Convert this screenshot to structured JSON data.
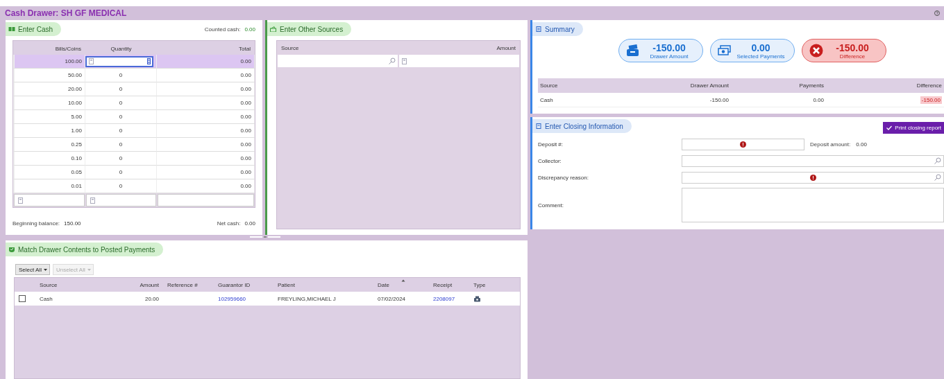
{
  "window": {
    "title": "Cash Drawer: SH GF MEDICAL"
  },
  "enter_cash": {
    "title": "Enter Cash",
    "counted_cash_label": "Counted cash:",
    "counted_cash": "0.00",
    "columns": [
      "Bills/Coins",
      "Quantity",
      "Total"
    ],
    "rows": [
      {
        "denomination": "100.00",
        "total": "0.00",
        "selected": true
      },
      {
        "denomination": "50.00",
        "quantity": "0",
        "total": "0.00",
        "selected": false
      },
      {
        "denomination": "20.00",
        "quantity": "0",
        "total": "0.00",
        "selected": false
      },
      {
        "denomination": "10.00",
        "quantity": "0",
        "total": "0.00",
        "selected": false
      },
      {
        "denomination": "5.00",
        "quantity": "0",
        "total": "0.00",
        "selected": false
      },
      {
        "denomination": "1.00",
        "quantity": "0",
        "total": "0.00",
        "selected": false
      },
      {
        "denomination": "0.25",
        "quantity": "0",
        "total": "0.00",
        "selected": false
      },
      {
        "denomination": "0.10",
        "quantity": "0",
        "total": "0.00",
        "selected": false
      },
      {
        "denomination": "0.05",
        "quantity": "0",
        "total": "0.00",
        "selected": false
      },
      {
        "denomination": "0.01",
        "quantity": "0",
        "total": "0.00",
        "selected": false
      }
    ],
    "beginning_balance_label": "Beginning balance:",
    "beginning_balance": "150.00",
    "net_cash_label": "Net cash:",
    "net_cash": "0.00"
  },
  "other_sources": {
    "title": "Enter Other Sources",
    "columns": [
      "Source",
      "Amount"
    ]
  },
  "summary": {
    "title": "Summary",
    "tiles": [
      {
        "kind": "drawer",
        "value": "-150.00",
        "label": "Drawer Amount"
      },
      {
        "kind": "payments",
        "value": "0.00",
        "label": "Selected Payments"
      },
      {
        "kind": "difference",
        "value": "-150.00",
        "label": "Difference"
      }
    ],
    "columns": [
      "Source",
      "Drawer Amount",
      "Payments",
      "Difference"
    ],
    "rows": [
      {
        "source": "Cash",
        "drawer_amount": "-150.00",
        "payments": "0.00",
        "difference": "-150.00"
      }
    ]
  },
  "closing": {
    "title": "Enter Closing Information",
    "print_button": "Print closing report",
    "deposit_amount_label": "Deposit amount:",
    "deposit_amount": "0.00",
    "fields": [
      {
        "kind": "text",
        "label": "Deposit #:",
        "required": true
      },
      {
        "kind": "lookup",
        "label": "Collector:",
        "required": false
      },
      {
        "kind": "lookup",
        "label": "Discrepancy reason:",
        "required": true
      },
      {
        "kind": "memo",
        "label": "Comment:",
        "required": false
      }
    ]
  },
  "match": {
    "title": "Match Drawer Contents to Posted Payments",
    "select_all": "Select All",
    "unselect_all": "Unselect All",
    "unselect_disabled": true,
    "columns": [
      "Source",
      "Amount",
      "Reference #",
      "Guarantor ID",
      "Patient",
      "Date",
      "Receipt",
      "Type"
    ],
    "rows": [
      {
        "checked": false,
        "source": "Cash",
        "amount": "20.00",
        "guarantor_id": "102959660",
        "patient": "FREYLING,MICHAEL J",
        "date": "07/02/2024",
        "receipt": "2208097"
      }
    ]
  }
}
